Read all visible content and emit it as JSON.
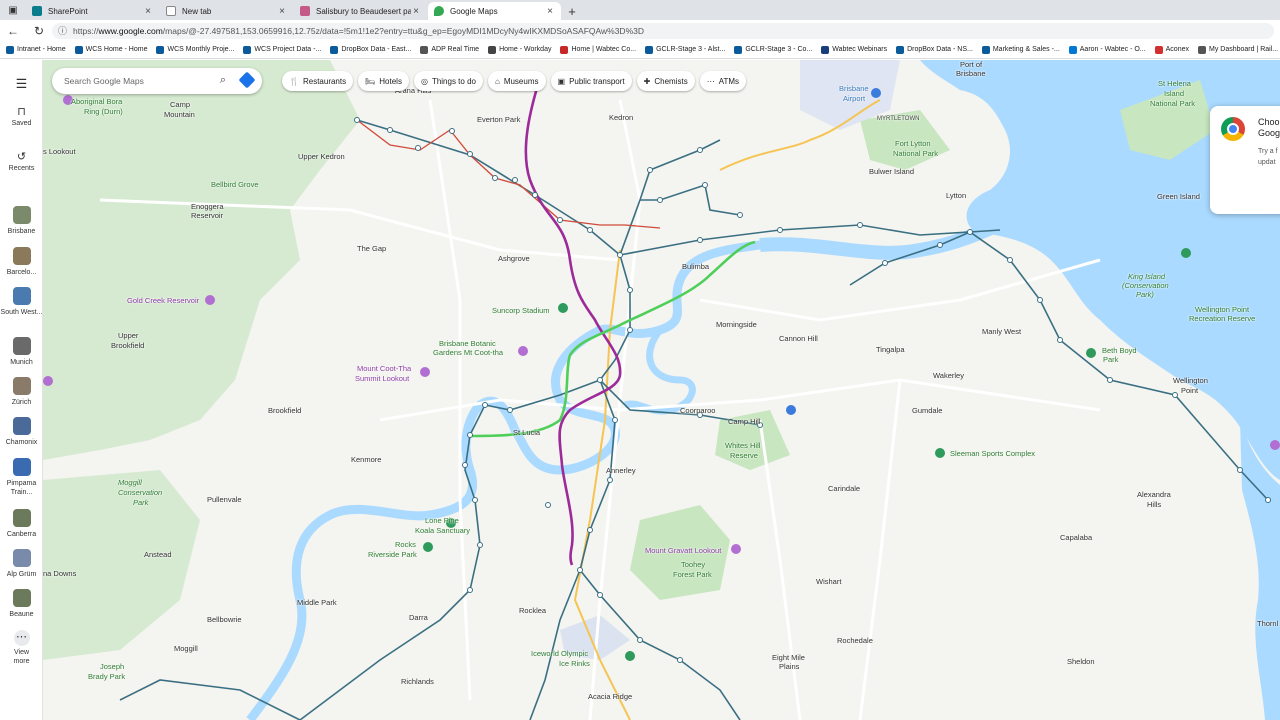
{
  "browser": {
    "tabs": [
      {
        "title": "SharePoint",
        "color": "#0a7c8c",
        "active": false
      },
      {
        "title": "New tab",
        "color": "#888888",
        "active": false
      },
      {
        "title": "Salisbury to Beaudesert passenge",
        "color": "#c45a88",
        "active": false
      },
      {
        "title": "Google Maps",
        "color": "#34a853",
        "active": true
      }
    ],
    "url_prefix": "https://",
    "url_domain": "www.google.com",
    "url_rest": "/maps/@-27.497581,153.0659916,12.75z/data=!5m1!1e2?entry=ttu&g_ep=EgoyMDI1MDcyNy4wIKXMDSoASAFQAw%3D%3D"
  },
  "bookmarks": [
    {
      "label": "Intranet - Home",
      "color": "#0a5a9c"
    },
    {
      "label": "WCS Home - Home",
      "color": "#0a5a9c"
    },
    {
      "label": "WCS Monthly Proje...",
      "color": "#0a5a9c"
    },
    {
      "label": "WCS Project Data -...",
      "color": "#0a5a9c"
    },
    {
      "label": "DropBox Data - East...",
      "color": "#0a5a9c"
    },
    {
      "label": "ADP Real Time",
      "color": "#555555"
    },
    {
      "label": "Home - Workday",
      "color": "#444444"
    },
    {
      "label": "Home | Wabtec Co...",
      "color": "#c62828"
    },
    {
      "label": "GCLR-Stage 3 - Alst...",
      "color": "#0a5a9c"
    },
    {
      "label": "GCLR-Stage 3 - Co...",
      "color": "#0a5a9c"
    },
    {
      "label": "Wabtec Webinars",
      "color": "#1a3d7c"
    },
    {
      "label": "DropBox Data - NS...",
      "color": "#0a5a9c"
    },
    {
      "label": "Marketing & Sales -...",
      "color": "#0a5a9c"
    },
    {
      "label": "Aaron - Wabtec - O...",
      "color": "#0078d4"
    },
    {
      "label": "Aconex",
      "color": "#d32f2f"
    },
    {
      "label": "My Dashboard | Rail...",
      "color": "#555555"
    }
  ],
  "rail": {
    "saved": "Saved",
    "recents": "Recents",
    "places": [
      "Brisbane",
      "Barcelo...",
      "South West...",
      "Munich",
      "Zürich",
      "Chamonix",
      "Pimpama Train...",
      "Canberra",
      "Alp Grüm",
      "Beaune"
    ],
    "view_more": "View more"
  },
  "search": {
    "placeholder": "Search Google Maps"
  },
  "chips": [
    {
      "label": "Restaurants",
      "icon": "🍴"
    },
    {
      "label": "Hotels",
      "icon": "🛏"
    },
    {
      "label": "Things to do",
      "icon": "◎"
    },
    {
      "label": "Museums",
      "icon": "⌂"
    },
    {
      "label": "Public transport",
      "icon": "▣"
    },
    {
      "label": "Chemists",
      "icon": "✚"
    },
    {
      "label": "ATMs",
      "icon": "⋯"
    }
  ],
  "popup": {
    "heading_1": "Choo",
    "heading_2": "Goog",
    "body_1": "Try a f",
    "body_2": "updat"
  },
  "places": {
    "aboriginal_1": "Aboriginal Bora",
    "aboriginal_2": "Ring (Durn)",
    "camp_mountain_1": "Camp",
    "camp_mountain_2": "Mountain",
    "s_lookout": "s Lookout",
    "upper_kedron": "Upper Kedron",
    "everton_park": "Everton Park",
    "kedron": "Kedron",
    "airport": "Brisbane",
    "airport_2": "Airport",
    "port_brisbane_1": "Port of",
    "port_brisbane_2": "Brisbane",
    "myrtletown": "MYRTLETOWN",
    "st_helena_1": "St Helena",
    "st_helena_2": "Island",
    "st_helena_3": "National Park",
    "arana": "Arana Hills",
    "bellbird": "Bellbird Grove",
    "enoggera_1": "Enoggera",
    "enoggera_2": "Reservoir",
    "the_gap": "The Gap",
    "ashgrove": "Ashgrove",
    "fort_lytton_1": "Fort Lytton",
    "fort_lytton_2": "National Park",
    "bulwer": "Bulwer Island",
    "lytton": "Lytton",
    "green_island": "Green Island",
    "bulimba": "Bulimba",
    "gold_creek": "Gold Creek Reservoir",
    "suncorp": "Suncorp Stadium",
    "morningside": "Morningside",
    "cannon_hill": "Cannon Hill",
    "king_island_1": "King Island",
    "king_island_2": "(Conservation",
    "king_island_3": "Park)",
    "wellington_pt_rec_1": "Wellington Point",
    "wellington_pt_rec_2": "Recreation Reserve",
    "manly_west": "Manly West",
    "upper_brookfield_1": "Upper",
    "upper_brookfield_2": "Brookfield",
    "botanic_1": "Brisbane Botanic",
    "botanic_2": "Gardens Mt Coot-tha",
    "tingalpa": "Tingalpa",
    "beth_boyd_1": "Beth Boyd",
    "beth_boyd_2": "Park",
    "mt_coot_tha_1": "Mount Coot-Tha",
    "mt_coot_tha_2": "Summit Lookout",
    "wakerley": "Wakerley",
    "wellington_point_1": "Wellington",
    "wellington_point_2": "Point",
    "brookfield": "Brookfield",
    "st_lucia": "St Lucia",
    "coorparoo": "Coorparoo",
    "camp_hill": "Camp Hill",
    "gumdale": "Gumdale",
    "whites_hill_1": "Whites Hill",
    "whites_hill_2": "Reserve",
    "kenmore": "Kenmore",
    "sleeman": "Sleeman Sports Complex",
    "annerley": "Annerley",
    "carindale": "Carindale",
    "alexandra_1": "Alexandra",
    "alexandra_2": "Hills",
    "moggill_cons_1": "Moggill",
    "moggill_cons_2": "Conservation",
    "moggill_cons_3": "Park",
    "pullenvale": "Pullenvale",
    "lone_pine_1": "Lone Pine",
    "lone_pine_2": "Koala Sanctuary",
    "rocks_1": "Rocks",
    "rocks_2": "Riverside Park",
    "capalaba": "Capalaba",
    "mt_gravatt": "Mount Gravatt Lookout",
    "toohey_1": "Toohey",
    "toohey_2": "Forest Park",
    "anstead": "Anstead",
    "wishart": "Wishart",
    "downs": "na Downs",
    "middle_park": "Middle Park",
    "rocklea": "Rocklea",
    "bellbowrie": "Bellbowrie",
    "darra": "Darra",
    "rochedale": "Rochedale",
    "moggill": "Moggill",
    "iceworld_1": "Iceworld Olympic",
    "iceworld_2": "Ice Rinks",
    "eight_mile_1": "Eight Mile",
    "eight_mile_2": "Plains",
    "sheldon": "Sheldon",
    "joseph_1": "Joseph",
    "joseph_2": "Brady Park",
    "richlands": "Richlands",
    "acacia": "Acacia Ridge",
    "thornl": "Thornl"
  },
  "colors": {
    "water": "#aadaff",
    "park": "#c8e6c0",
    "transit_line": "#3a6f82",
    "train_line": "#d04a3a",
    "purple_route": "#9c2a99",
    "green_route": "#4caf50",
    "highway": "#f6c453"
  }
}
